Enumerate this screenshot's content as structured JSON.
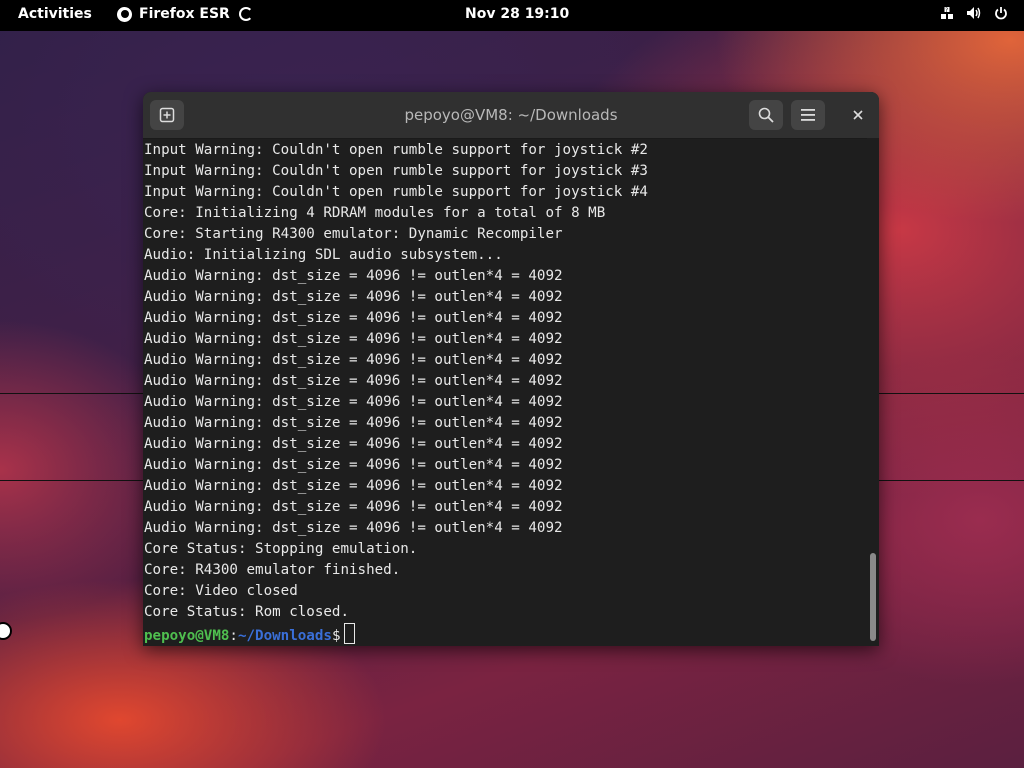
{
  "topbar": {
    "activities": "Activities",
    "app_name": "Firefox ESR",
    "clock": "Nov 28  19:10"
  },
  "window": {
    "title": "pepoyo@VM8: ~/Downloads"
  },
  "terminal": {
    "lines": [
      "Input Warning: Couldn't open rumble support for joystick #2",
      "Input Warning: Couldn't open rumble support for joystick #3",
      "Input Warning: Couldn't open rumble support for joystick #4",
      "Core: Initializing 4 RDRAM modules for a total of 8 MB",
      "Core: Starting R4300 emulator: Dynamic Recompiler",
      "Audio: Initializing SDL audio subsystem...",
      "Audio Warning: dst_size = 4096 != outlen*4 = 4092",
      "Audio Warning: dst_size = 4096 != outlen*4 = 4092",
      "Audio Warning: dst_size = 4096 != outlen*4 = 4092",
      "Audio Warning: dst_size = 4096 != outlen*4 = 4092",
      "Audio Warning: dst_size = 4096 != outlen*4 = 4092",
      "Audio Warning: dst_size = 4096 != outlen*4 = 4092",
      "Audio Warning: dst_size = 4096 != outlen*4 = 4092",
      "Audio Warning: dst_size = 4096 != outlen*4 = 4092",
      "Audio Warning: dst_size = 4096 != outlen*4 = 4092",
      "Audio Warning: dst_size = 4096 != outlen*4 = 4092",
      "Audio Warning: dst_size = 4096 != outlen*4 = 4092",
      "Audio Warning: dst_size = 4096 != outlen*4 = 4092",
      "Audio Warning: dst_size = 4096 != outlen*4 = 4092",
      "Core Status: Stopping emulation.",
      "Core: R4300 emulator finished.",
      "Core: Video closed",
      "Core Status: Rom closed."
    ],
    "prompt_user": "pepoyo@VM8",
    "prompt_sep": ":",
    "prompt_path": "~/Downloads",
    "prompt_symbol": "$"
  },
  "colors": {
    "prompt_user": "#4fbf4f",
    "prompt_path": "#3a6fd8",
    "terminal_bg": "#1e1e1e"
  }
}
